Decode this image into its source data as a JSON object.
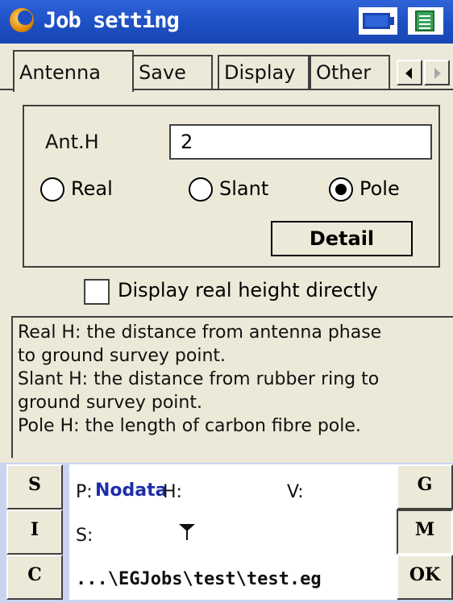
{
  "window": {
    "title": "Job setting",
    "icons": [
      "app-icon",
      "battery-icon",
      "sip-keyboard-icon"
    ]
  },
  "tabs": [
    {
      "label": "Antenna",
      "active": true
    },
    {
      "label": "Save",
      "active": false
    },
    {
      "label": "Display",
      "active": false
    },
    {
      "label": "Other",
      "active": false
    }
  ],
  "antenna": {
    "ant_h_label": "Ant.H",
    "ant_h_value": "2",
    "radios": [
      {
        "label": "Real",
        "selected": false
      },
      {
        "label": "Slant",
        "selected": false
      },
      {
        "label": "Pole",
        "selected": true
      }
    ],
    "detail_button": "Detail",
    "checkbox_label": "Display real height directly",
    "checkbox_checked": false,
    "help_lines": [
      "Real  H: the distance from antenna phase",
      "to ground survey point.",
      "Slant H: the distance from rubber ring to",
      "ground survey point.",
      "Pole  H: the length of carbon fibre pole."
    ]
  },
  "left_buttons": [
    "S",
    "I",
    "C"
  ],
  "right_buttons": [
    "G",
    "M",
    "OK"
  ],
  "status": {
    "p_label": "P:",
    "p_value": "Nodata",
    "h_label": "H:",
    "v_label": "V:",
    "s_label": "S:",
    "path": "...\\EGJobs\\test\\test.eg"
  }
}
